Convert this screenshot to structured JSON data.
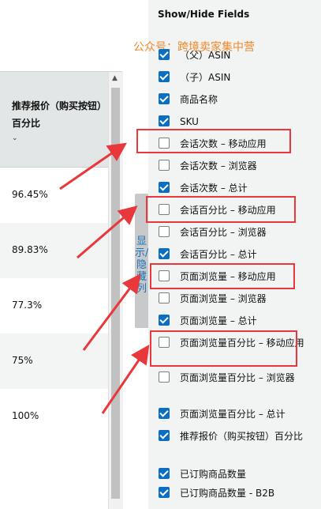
{
  "table": {
    "column_header": "推荐报价（购买按钮）百分比",
    "sort_indicator": "⌄",
    "scroll_up": "▲",
    "rows": [
      "96.45%",
      "89.83%",
      "77.3%",
      "75%",
      "100%"
    ]
  },
  "vertical_tab": "显示/隐藏列",
  "panel": {
    "title": "Show/Hide Fields",
    "watermark": "公众号：跨境卖家集中营",
    "fields": [
      {
        "label": "（父）ASIN",
        "checked": true
      },
      {
        "label": "（子）ASIN",
        "checked": true
      },
      {
        "label": "商品名称",
        "checked": true
      },
      {
        "label": "SKU",
        "checked": true
      },
      {
        "label": "会话次数 – 移动应用",
        "checked": false
      },
      {
        "label": "会话次数 – 浏览器",
        "checked": false
      },
      {
        "label": "会话次数 – 总计",
        "checked": true
      },
      {
        "label": "会话百分比 – 移动应用",
        "checked": false
      },
      {
        "label": "会话百分比 – 浏览器",
        "checked": false
      },
      {
        "label": "会话百分比 – 总计",
        "checked": true
      },
      {
        "label": "页面浏览量 – 移动应用",
        "checked": false
      },
      {
        "label": "页面浏览量 – 浏览器",
        "checked": false
      },
      {
        "label": "页面浏览量 – 总计",
        "checked": true
      },
      {
        "label": "页面浏览量百分比 – 移动应用",
        "checked": false
      },
      {
        "label": "页面浏览量百分比 – 浏览器",
        "checked": false
      },
      {
        "label": "页面浏览量百分比 – 总计",
        "checked": true
      },
      {
        "label": "推荐报价（购买按钮）百分比",
        "checked": true
      },
      {
        "label": "已订购商品数量",
        "checked": true
      },
      {
        "label": "已订购商品数量 - B2B",
        "checked": true
      }
    ]
  },
  "colors": {
    "highlight": "#e8383c",
    "accent": "#0b6ec2",
    "watermark": "#f08a2c"
  }
}
